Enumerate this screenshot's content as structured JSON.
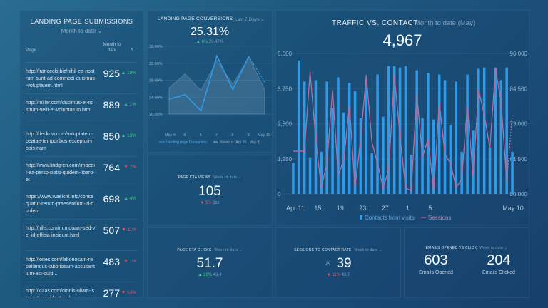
{
  "landing_page_submissions": {
    "title": "LANDING PAGE SUBMISSIONS",
    "range": "Month to date ⌄",
    "col_page": "Page",
    "col_mtd": "Month to date",
    "col_delta": "Δ",
    "rows": [
      {
        "url": "http://francecki.biz/nihil-ea-nostrum-sunt-ad-commodi-ducimus-voluptatem.html",
        "value": "925",
        "change": "▲ 19%",
        "dir": "up"
      },
      {
        "url": "http://miller.com/ducimus-et-nostrum-velit-et-voluptatum.html",
        "value": "889",
        "change": "▲ 1%",
        "dir": "up"
      },
      {
        "url": "http://deckow.com/voluptatem-beatae-temporibus-excepturi-nobis-nam",
        "value": "850",
        "change": "▲ 13%",
        "dir": "up"
      },
      {
        "url": "http://www.lindgren.com/impedit-ea-perspiciatis-quidem-libero-et",
        "value": "764",
        "change": "▼ 7%",
        "dir": "down"
      },
      {
        "url": "https://www.waelchi.info/consequatur-rerum-praesentium-id-quidem",
        "value": "698",
        "change": "▲ 4%",
        "dir": "up"
      },
      {
        "url": "http://hills.com/numquam-sed-vel-id-officia-incidunt.html",
        "value": "507",
        "change": "▼ 11%",
        "dir": "down"
      },
      {
        "url": "http://jones.com/laboriosam-repellendus-laboriosam-accusantium-est-quid...",
        "value": "483",
        "change": "▼ 1%",
        "dir": "down"
      },
      {
        "url": "http://kulas.com/omnis-ullam-iste-aut-provident-sed-",
        "value": "277",
        "change": "▼ 14%",
        "dir": "down"
      }
    ]
  },
  "landing_page_conversions": {
    "title": "LANDING PAGE CONVERSIONS",
    "range": "Last 7 Days ⌄",
    "value": "25.31%",
    "change": "▲ 8%",
    "prev": "23.47%",
    "legend_current": "Landing page Conversion",
    "legend_previous": "Previous (Apr 26 - May 3)"
  },
  "page_cta_views": {
    "title": "PAGE CTA VIEWS",
    "range": "Week to date ⌄",
    "value": "105",
    "change": "▼ 5%",
    "prev": "111"
  },
  "page_cta_clicks": {
    "title": "PAGE CTA CLICKS",
    "range": "Week to date ⌄",
    "value": "51.7",
    "change": "▲ 19%",
    "prev": "43.4"
  },
  "sessions_to_contact_rate": {
    "title": "SESSIONS TO CONTACT RATE",
    "range": "Week to date ⌄",
    "value": "39",
    "change": "▼ 11%",
    "prev": "43.7"
  },
  "emails_opened_vs_click": {
    "title": "EMAILS OPENED VS CLICK",
    "range": "Week to date ⌄",
    "opened_value": "603",
    "opened_label": "Emails Opened",
    "clicked_value": "204",
    "clicked_label": "Emails Clicked"
  },
  "traffic_vs_contact": {
    "title": "TRAFFIC VS. CONTACT",
    "range": "Month to date (May)",
    "value": "4,967",
    "legend_contacts": "Contacts from visits",
    "legend_sessions": "Sessions"
  },
  "colors": {
    "bar": "#2f9ae8",
    "session_line": "#b26fa3",
    "conv_line": "#2f9ae8",
    "up": "#3ed08a",
    "down": "#f0566a"
  },
  "chart_data": [
    {
      "type": "line",
      "name": "landing_page_conversions",
      "categories": [
        "May 4",
        "5",
        "6",
        "7",
        "8",
        "9",
        "May 10"
      ],
      "ylim": [
        20,
        36
      ],
      "yticks": [
        "36.00%",
        "32.00%",
        "28.00%",
        "24.00%",
        "20.00%"
      ],
      "series": [
        {
          "name": "Landing page Conversion",
          "values": [
            23.5,
            24.6,
            20.8,
            33.7,
            25.8,
            33.6,
            27.6
          ]
        },
        {
          "name": "Previous (Apr 26 - May 3)",
          "values": [
            26.2,
            29.5,
            25.6,
            32.6,
            27.1,
            33.4,
            25.9
          ]
        }
      ]
    },
    {
      "type": "bar",
      "name": "traffic_vs_contact",
      "xticks": [
        "Apr 11",
        "15",
        "19",
        "23",
        "27",
        "1",
        "5",
        "May 10"
      ],
      "left_ylim": [
        0,
        5000
      ],
      "left_yticks": [
        "5,000",
        "3,750",
        "2,500",
        "1,250",
        "0"
      ],
      "right_ylim": [
        50000,
        96000
      ],
      "right_yticks": [
        "96,000",
        "84,500",
        "73,000",
        "61,500",
        "50,000"
      ],
      "series": [
        {
          "name": "Contacts from visits",
          "values": [
            1100,
            4750,
            4000,
            1300,
            4050,
            1500,
            4000,
            3050,
            4150,
            2900,
            3950,
            3650,
            2700,
            4050,
            1450,
            4250,
            2750,
            4550,
            4550,
            4500,
            4550,
            1400,
            4400,
            2700,
            4300,
            2650,
            4250,
            4050,
            2450,
            4000,
            1500,
            4250,
            2250,
            4450,
            4500,
            1650,
            4500,
            4050,
            4500,
            1500
          ]
        },
        {
          "name": "Sessions",
          "values": [
            64000,
            64000,
            64000,
            90000,
            68000,
            52000,
            60000,
            84000,
            56000,
            61000,
            79000,
            52000,
            68000,
            89000,
            67000,
            60000,
            52000,
            58000,
            89000,
            69000,
            52000,
            51000,
            83000,
            62000,
            68000,
            51000,
            80000,
            63000,
            60000,
            52000,
            55000,
            79000,
            56000,
            84000,
            76000,
            65000,
            91000,
            80000,
            54000,
            76000
          ]
        }
      ]
    }
  ]
}
